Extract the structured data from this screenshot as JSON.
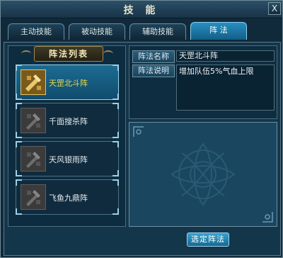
{
  "window": {
    "title": "技 能",
    "close_label": "X"
  },
  "tabs": [
    {
      "label": "主动技能"
    },
    {
      "label": "被动技能"
    },
    {
      "label": "辅助技能"
    },
    {
      "label": "阵 法",
      "active": true
    }
  ],
  "formation_list": {
    "header": "阵法列表",
    "items": [
      {
        "label": "天罡北斗阵",
        "selected": true,
        "icon": "formation-gold-icon"
      },
      {
        "label": "千面搜杀阵",
        "icon": "formation-locked-icon"
      },
      {
        "label": "天风银雨阵",
        "icon": "formation-locked-icon"
      },
      {
        "label": "飞鱼九鼎阵",
        "icon": "formation-locked-icon"
      }
    ]
  },
  "details": {
    "name_label": "阵法名称",
    "name_value": "天罡北斗阵",
    "desc_label": "阵法说明",
    "desc_value": "增加队伍5%气血上限"
  },
  "actions": {
    "confirm_label": "选定阵法"
  },
  "colors": {
    "accent": "#2a8ec0",
    "gold": "#e7d94b",
    "panel": "#14364a"
  }
}
